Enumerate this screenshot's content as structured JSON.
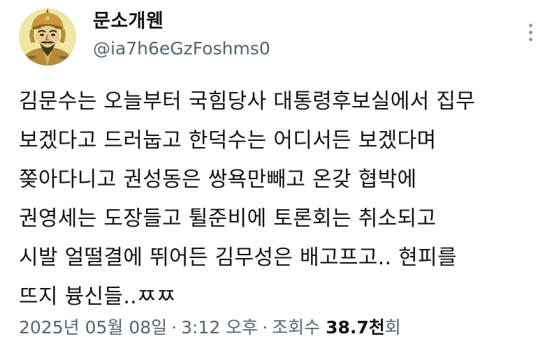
{
  "author": {
    "display_name": "문소개웬",
    "handle": "@ia7h6eGzFoshms0",
    "avatar_icon": "general-portrait-avatar"
  },
  "tweet": {
    "lines": [
      "김문수는 오늘부터 국힘당사 대통령후보실에서 집무",
      "보겠다고 드러눕고 한덕수는 어디서든 보겠다며",
      "쫒아다니고 권성동은 쌍욕만빼고 온갖 협박에",
      "권영세는 도장들고 튈준비에 토론회는 취소되고",
      "시발 얼떨결에 뛰어든 김무성은 배고프고.. 현피를",
      "뜨지 븅신들..ㅉㅉ"
    ]
  },
  "meta": {
    "date": "2025년 05월 08일",
    "separator": "·",
    "time": "3:12 오후",
    "views_label": "조회수",
    "views_count": "38.7천",
    "views_suffix": "회"
  },
  "colors": {
    "text_primary": "#0f1419",
    "text_secondary": "#536471",
    "avatar_background": "#efe6a6"
  },
  "icons": {
    "more": "more-vertical-icon"
  }
}
